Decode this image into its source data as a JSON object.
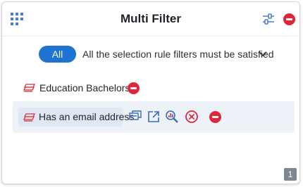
{
  "header": {
    "title": "Multi Filter",
    "menu_icon": "grid-menu-icon",
    "settings_icon": "filter-settings-icon",
    "remove_icon": "remove-circle-icon"
  },
  "mode": {
    "selected": "All",
    "description": "All the selection rule filters must be satisfied",
    "dropdown_icon": "chevron-down-icon"
  },
  "rules": [
    {
      "label": "Education Bachelors",
      "icon": "tag-stack-icon"
    },
    {
      "label": "Has an email address",
      "icon": "tag-stack-icon",
      "tools": [
        "copy-icon",
        "open-external-icon",
        "zoom-chart-icon",
        "cancel-circle-icon",
        "remove-circle-icon"
      ]
    }
  ],
  "page_number": "1",
  "colors": {
    "accent": "#1e74d0",
    "danger": "#e0263a",
    "cancel": "#e0263a",
    "icon_blue": "#3a6bb8",
    "row_highlight": "#edf2f9"
  }
}
